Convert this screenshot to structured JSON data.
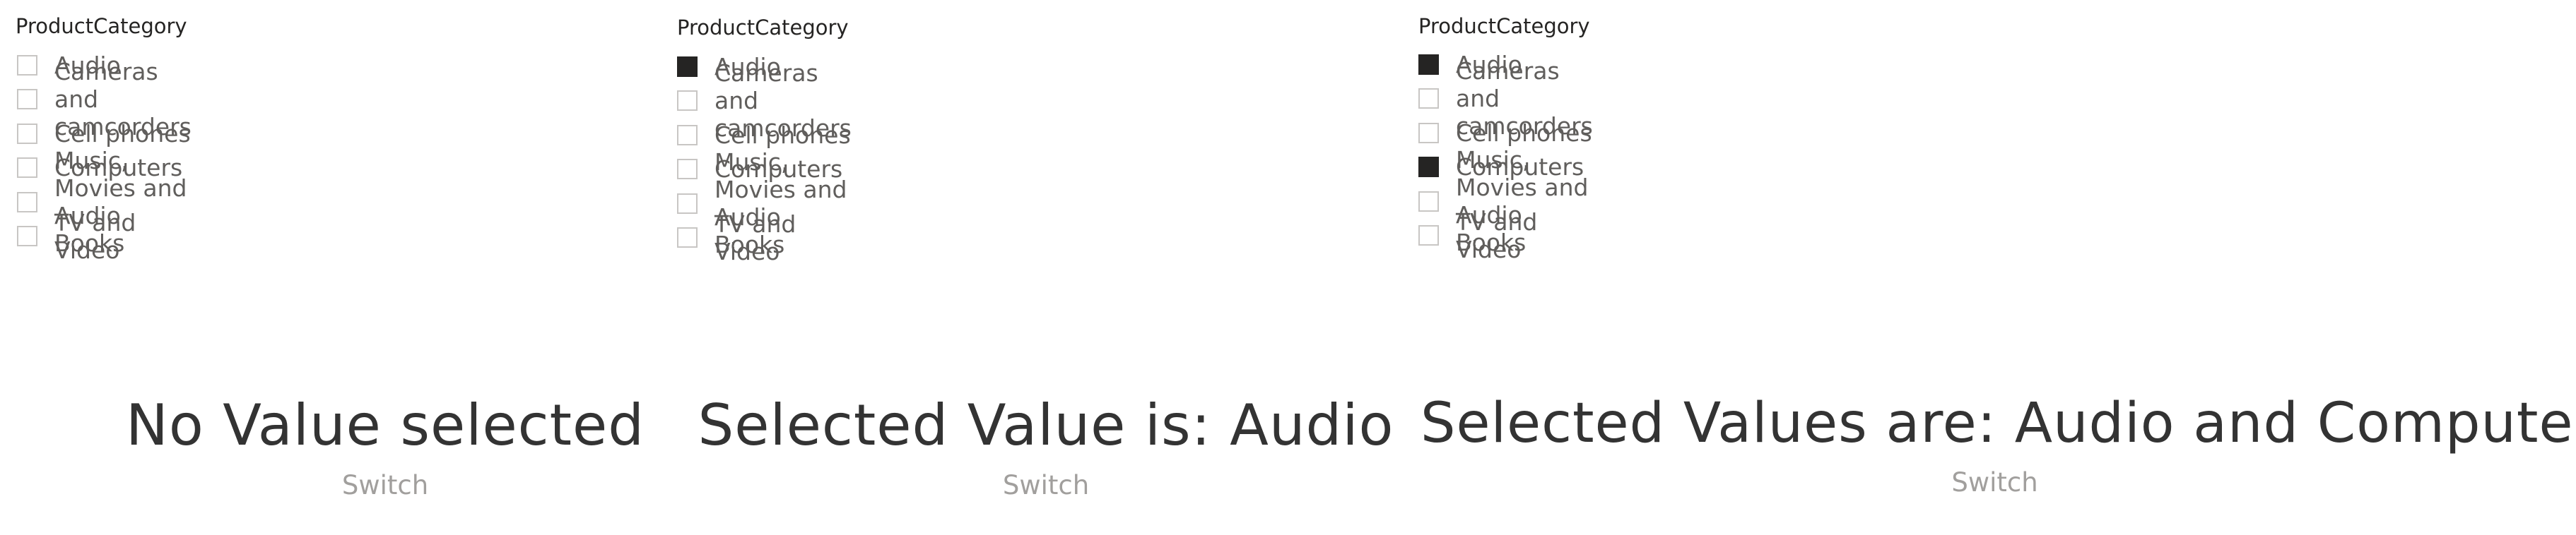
{
  "slicers": [
    {
      "header": "ProductCategory",
      "items": [
        {
          "label": "Audio",
          "checked": false
        },
        {
          "label": "Cameras and camcorders",
          "checked": false
        },
        {
          "label": "Cell phones",
          "checked": false
        },
        {
          "label": "Computers",
          "checked": false
        },
        {
          "label": "Music, Movies and Audio Books",
          "checked": false
        },
        {
          "label": "TV and Video",
          "checked": false
        }
      ]
    },
    {
      "header": "ProductCategory",
      "items": [
        {
          "label": "Audio",
          "checked": true
        },
        {
          "label": "Cameras and camcorders",
          "checked": false
        },
        {
          "label": "Cell phones",
          "checked": false
        },
        {
          "label": "Computers",
          "checked": false
        },
        {
          "label": "Music, Movies and Audio Books",
          "checked": false
        },
        {
          "label": "TV and Video",
          "checked": false
        }
      ]
    },
    {
      "header": "ProductCategory",
      "items": [
        {
          "label": "Audio",
          "checked": true
        },
        {
          "label": "Cameras and camcorders",
          "checked": false
        },
        {
          "label": "Cell phones",
          "checked": false
        },
        {
          "label": "Computers",
          "checked": true
        },
        {
          "label": "Music, Movies and Audio Books",
          "checked": false
        },
        {
          "label": "TV and Video",
          "checked": false
        }
      ]
    }
  ],
  "cards": [
    {
      "value": "No Value selected",
      "caption": "Switch"
    },
    {
      "value": "Selected Value is: Audio",
      "caption": "Switch"
    },
    {
      "value": "Selected Values are: Audio and Computers",
      "caption": "Switch"
    }
  ]
}
